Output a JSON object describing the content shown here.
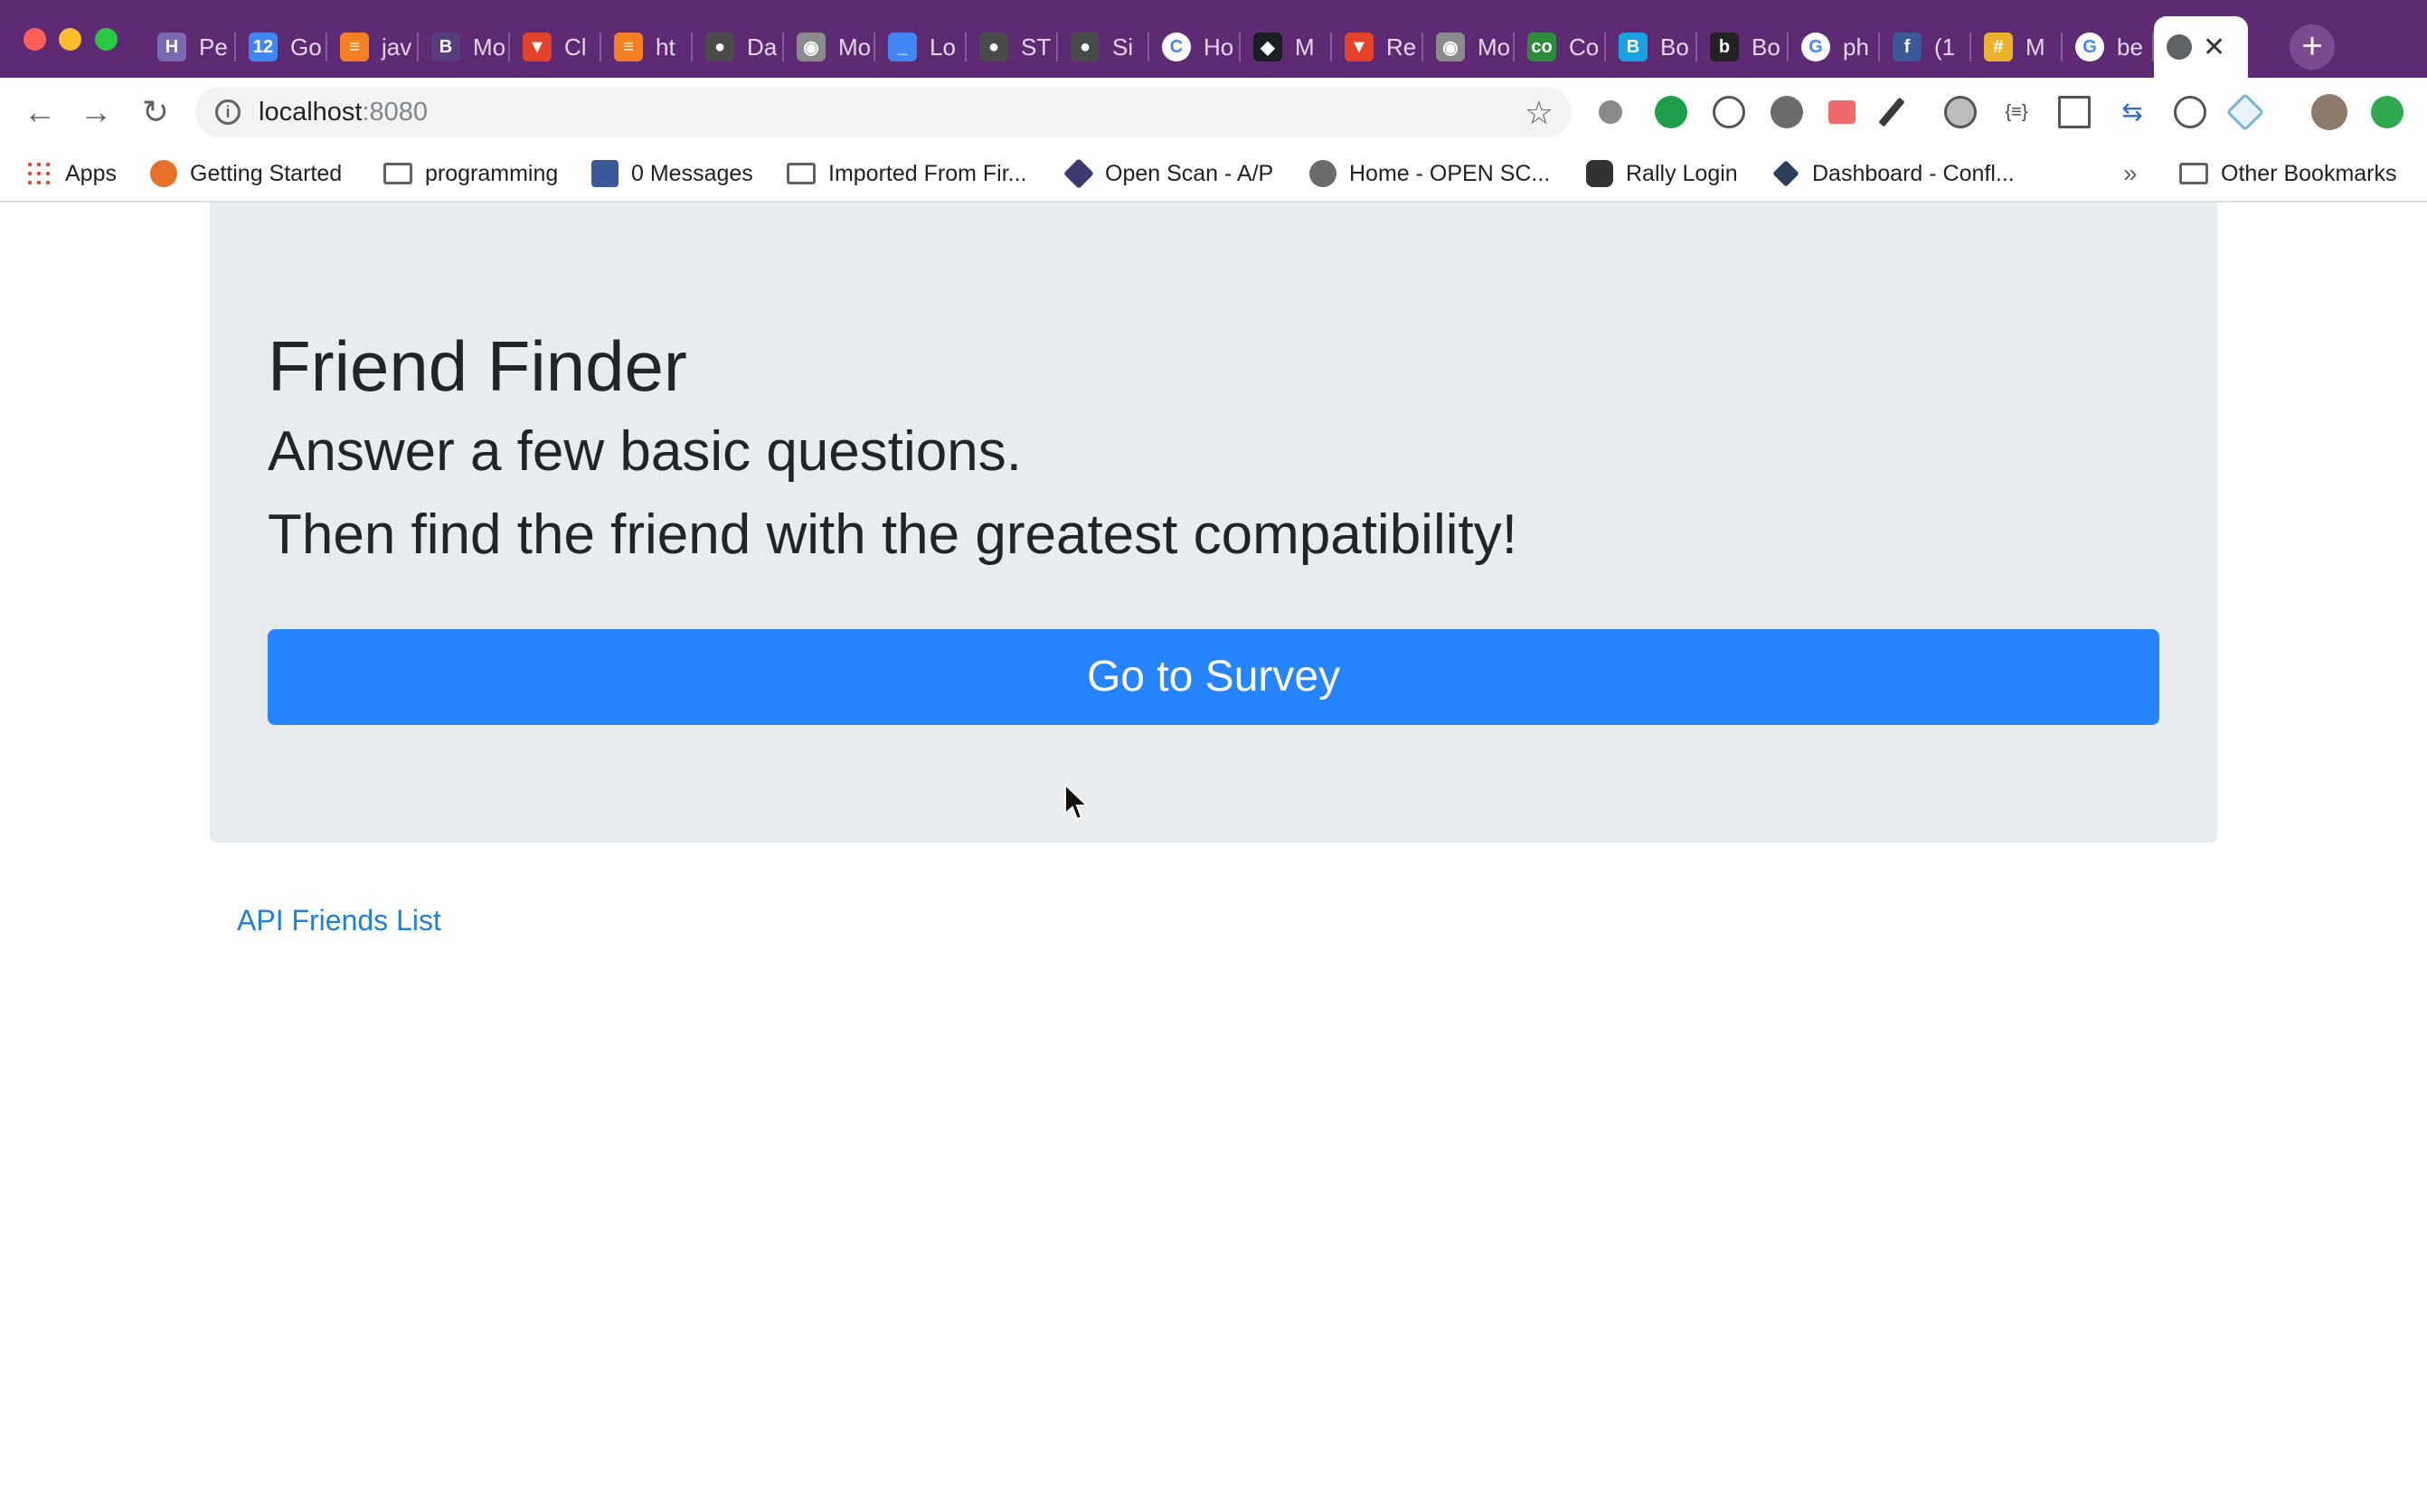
{
  "browser": {
    "tabs": [
      {
        "title": "Pe",
        "icon": "heroku-icon",
        "color": "#7a6bb0",
        "glyph": "H"
      },
      {
        "title": "Go",
        "icon": "calendar-icon",
        "color": "#4285f4",
        "glyph": "12"
      },
      {
        "title": "jav",
        "icon": "stackoverflow-icon",
        "color": "#f48024",
        "glyph": "≡"
      },
      {
        "title": "Mo",
        "icon": "bootstrap-icon",
        "color": "#563d7c",
        "glyph": "B"
      },
      {
        "title": "Cl",
        "icon": "gitlab-icon",
        "color": "#e24329",
        "glyph": "▼"
      },
      {
        "title": "ht",
        "icon": "stackoverflow-icon",
        "color": "#f48024",
        "glyph": "≡"
      },
      {
        "title": "Da",
        "icon": "globe-icon",
        "color": "#4a4a4a",
        "glyph": "●"
      },
      {
        "title": "Mo",
        "icon": "mongodb-icon",
        "color": "#8b8b8b",
        "glyph": "◉"
      },
      {
        "title": "Lo",
        "icon": "line-icon",
        "color": "#4285f4",
        "glyph": "_"
      },
      {
        "title": "ST",
        "icon": "globe-icon",
        "color": "#4a4a4a",
        "glyph": "●"
      },
      {
        "title": "Si",
        "icon": "globe-icon",
        "color": "#4a4a4a",
        "glyph": "●"
      },
      {
        "title": "Ho",
        "icon": "codecademy-icon",
        "color": "#ffffff",
        "glyph": "C"
      },
      {
        "title": "M",
        "icon": "github-icon",
        "color": "#1b1f23",
        "glyph": "◆"
      },
      {
        "title": "Re",
        "icon": "gitlab-icon",
        "color": "#e24329",
        "glyph": "▼"
      },
      {
        "title": "Mo",
        "icon": "mongodb-icon",
        "color": "#8b8b8b",
        "glyph": "◉"
      },
      {
        "title": "Co",
        "icon": "co-icon",
        "color": "#2e8b3a",
        "glyph": "co"
      },
      {
        "title": "Bo",
        "icon": "bootstrap-icon",
        "color": "#1ba1e2",
        "glyph": "B"
      },
      {
        "title": "Bo",
        "icon": "bootstrap-icon",
        "color": "#222222",
        "glyph": "b"
      },
      {
        "title": "ph",
        "icon": "google-icon",
        "color": "#ffffff",
        "glyph": "G"
      },
      {
        "title": "(1",
        "icon": "facebook-icon",
        "color": "#3b5998",
        "glyph": "f"
      },
      {
        "title": "M",
        "icon": "slack-icon",
        "color": "#ecb22e",
        "glyph": "#"
      },
      {
        "title": "be",
        "icon": "google-icon",
        "color": "#ffffff",
        "glyph": "G"
      }
    ],
    "url_host": "localhost",
    "url_port": ":8080",
    "bookmarks": [
      {
        "label": "Apps",
        "icon": "apps-grid-icon"
      },
      {
        "label": "Getting Started",
        "icon": "firefox-icon"
      },
      {
        "label": "programming",
        "icon": "folder-icon"
      },
      {
        "label": "0 Messages",
        "icon": "facebook-icon"
      },
      {
        "label": "Imported From Fir...",
        "icon": "folder-icon"
      },
      {
        "label": "Open Scan - A/P",
        "icon": "diamond-icon"
      },
      {
        "label": "Home - OPEN SC...",
        "icon": "globe-icon"
      },
      {
        "label": "Rally Login",
        "icon": "ca-icon"
      },
      {
        "label": "Dashboard - Confl...",
        "icon": "confluence-icon"
      }
    ],
    "more_bookmarks": "»",
    "other_bookmarks": "Other Bookmarks"
  },
  "page": {
    "title": "Friend Finder",
    "subtitle_line1": "Answer a few basic questions.",
    "subtitle_line2": "Then find the friend with the greatest compatibility!",
    "survey_button": "Go to Survey",
    "api_link": "API Friends List"
  },
  "colors": {
    "accent": "#2684ff",
    "jumbotron_bg": "#e9ecef",
    "link": "#1f7fe0",
    "tabstrip": "#5d2a73"
  }
}
